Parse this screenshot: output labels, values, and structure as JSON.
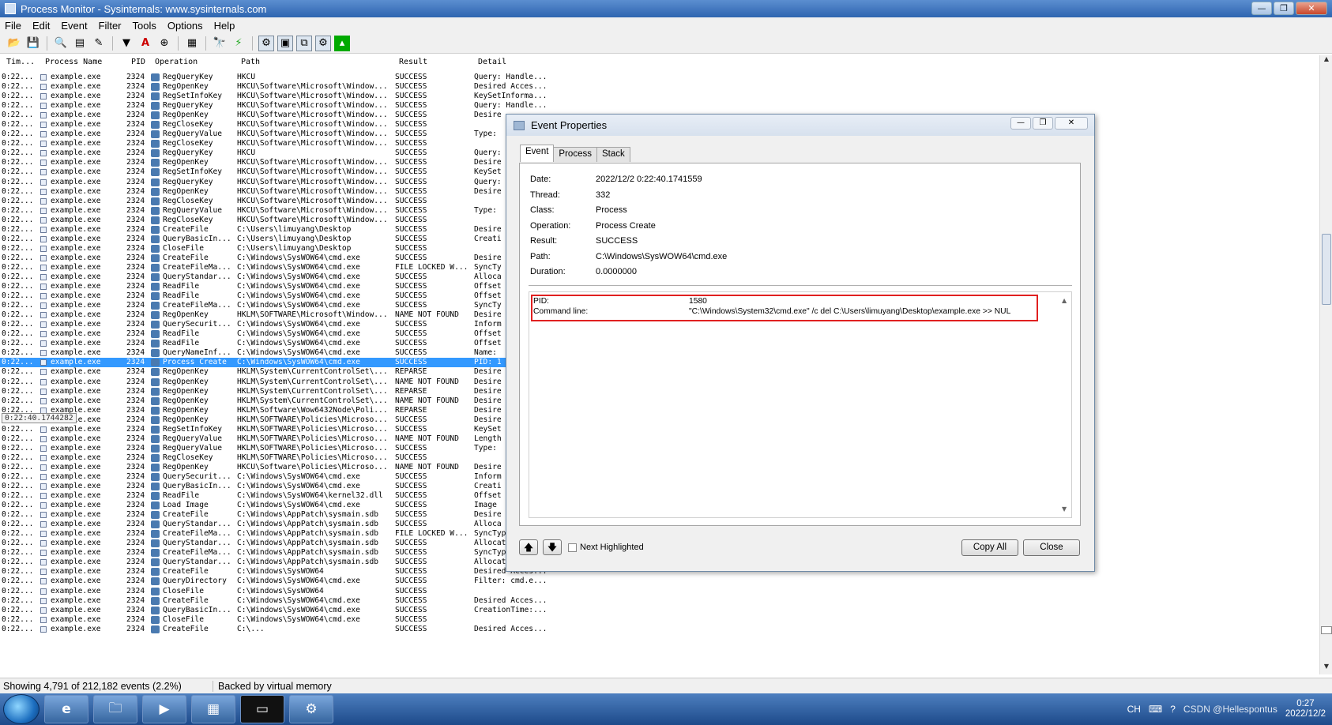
{
  "window": {
    "title": "Process Monitor - Sysinternals: www.sysinternals.com",
    "buttons": [
      "—",
      "❐",
      "✕"
    ]
  },
  "menu": [
    "File",
    "Edit",
    "Event",
    "Filter",
    "Tools",
    "Options",
    "Help"
  ],
  "columns": [
    "Tim...",
    "Process Name",
    "PID",
    "Operation",
    "Path",
    "Result",
    "Detail"
  ],
  "rows": [
    {
      "time": "0:22...",
      "proc": "example.exe",
      "pid": "2324",
      "op": "RegQueryKey",
      "path": "HKCU",
      "result": "SUCCESS",
      "detail": "Query: Handle..."
    },
    {
      "time": "0:22...",
      "proc": "example.exe",
      "pid": "2324",
      "op": "RegOpenKey",
      "path": "HKCU\\Software\\Microsoft\\Window...",
      "result": "SUCCESS",
      "detail": "Desired Acces..."
    },
    {
      "time": "0:22...",
      "proc": "example.exe",
      "pid": "2324",
      "op": "RegSetInfoKey",
      "path": "HKCU\\Software\\Microsoft\\Window...",
      "result": "SUCCESS",
      "detail": "KeySetInforma..."
    },
    {
      "time": "0:22...",
      "proc": "example.exe",
      "pid": "2324",
      "op": "RegQueryKey",
      "path": "HKCU\\Software\\Microsoft\\Window...",
      "result": "SUCCESS",
      "detail": "Query: Handle..."
    },
    {
      "time": "0:22...",
      "proc": "example.exe",
      "pid": "2324",
      "op": "RegOpenKey",
      "path": "HKCU\\Software\\Microsoft\\Window...",
      "result": "SUCCESS",
      "detail": "Desire"
    },
    {
      "time": "0:22...",
      "proc": "example.exe",
      "pid": "2324",
      "op": "RegCloseKey",
      "path": "HKCU\\Software\\Microsoft\\Window...",
      "result": "SUCCESS",
      "detail": ""
    },
    {
      "time": "0:22...",
      "proc": "example.exe",
      "pid": "2324",
      "op": "RegQueryValue",
      "path": "HKCU\\Software\\Microsoft\\Window...",
      "result": "SUCCESS",
      "detail": "Type:"
    },
    {
      "time": "0:22...",
      "proc": "example.exe",
      "pid": "2324",
      "op": "RegCloseKey",
      "path": "HKCU\\Software\\Microsoft\\Window...",
      "result": "SUCCESS",
      "detail": ""
    },
    {
      "time": "0:22...",
      "proc": "example.exe",
      "pid": "2324",
      "op": "RegQueryKey",
      "path": "HKCU",
      "result": "SUCCESS",
      "detail": "Query:"
    },
    {
      "time": "0:22...",
      "proc": "example.exe",
      "pid": "2324",
      "op": "RegOpenKey",
      "path": "HKCU\\Software\\Microsoft\\Window...",
      "result": "SUCCESS",
      "detail": "Desire"
    },
    {
      "time": "0:22...",
      "proc": "example.exe",
      "pid": "2324",
      "op": "RegSetInfoKey",
      "path": "HKCU\\Software\\Microsoft\\Window...",
      "result": "SUCCESS",
      "detail": "KeySet"
    },
    {
      "time": "0:22...",
      "proc": "example.exe",
      "pid": "2324",
      "op": "RegQueryKey",
      "path": "HKCU\\Software\\Microsoft\\Window...",
      "result": "SUCCESS",
      "detail": "Query:"
    },
    {
      "time": "0:22...",
      "proc": "example.exe",
      "pid": "2324",
      "op": "RegOpenKey",
      "path": "HKCU\\Software\\Microsoft\\Window...",
      "result": "SUCCESS",
      "detail": "Desire"
    },
    {
      "time": "0:22...",
      "proc": "example.exe",
      "pid": "2324",
      "op": "RegCloseKey",
      "path": "HKCU\\Software\\Microsoft\\Window...",
      "result": "SUCCESS",
      "detail": ""
    },
    {
      "time": "0:22...",
      "proc": "example.exe",
      "pid": "2324",
      "op": "RegQueryValue",
      "path": "HKCU\\Software\\Microsoft\\Window...",
      "result": "SUCCESS",
      "detail": "Type:"
    },
    {
      "time": "0:22...",
      "proc": "example.exe",
      "pid": "2324",
      "op": "RegCloseKey",
      "path": "HKCU\\Software\\Microsoft\\Window...",
      "result": "SUCCESS",
      "detail": ""
    },
    {
      "time": "0:22...",
      "proc": "example.exe",
      "pid": "2324",
      "op": "CreateFile",
      "path": "C:\\Users\\limuyang\\Desktop",
      "result": "SUCCESS",
      "detail": "Desire"
    },
    {
      "time": "0:22...",
      "proc": "example.exe",
      "pid": "2324",
      "op": "QueryBasicIn...",
      "path": "C:\\Users\\limuyang\\Desktop",
      "result": "SUCCESS",
      "detail": "Creati"
    },
    {
      "time": "0:22...",
      "proc": "example.exe",
      "pid": "2324",
      "op": "CloseFile",
      "path": "C:\\Users\\limuyang\\Desktop",
      "result": "SUCCESS",
      "detail": ""
    },
    {
      "time": "0:22...",
      "proc": "example.exe",
      "pid": "2324",
      "op": "CreateFile",
      "path": "C:\\Windows\\SysWOW64\\cmd.exe",
      "result": "SUCCESS",
      "detail": "Desire"
    },
    {
      "time": "0:22...",
      "proc": "example.exe",
      "pid": "2324",
      "op": "CreateFileMa...",
      "path": "C:\\Windows\\SysWOW64\\cmd.exe",
      "result": "FILE LOCKED W...",
      "detail": "SyncTy"
    },
    {
      "time": "0:22...",
      "proc": "example.exe",
      "pid": "2324",
      "op": "QueryStandar...",
      "path": "C:\\Windows\\SysWOW64\\cmd.exe",
      "result": "SUCCESS",
      "detail": "Alloca"
    },
    {
      "time": "0:22...",
      "proc": "example.exe",
      "pid": "2324",
      "op": "ReadFile",
      "path": "C:\\Windows\\SysWOW64\\cmd.exe",
      "result": "SUCCESS",
      "detail": "Offset"
    },
    {
      "time": "0:22...",
      "proc": "example.exe",
      "pid": "2324",
      "op": "ReadFile",
      "path": "C:\\Windows\\SysWOW64\\cmd.exe",
      "result": "SUCCESS",
      "detail": "Offset"
    },
    {
      "time": "0:22...",
      "proc": "example.exe",
      "pid": "2324",
      "op": "CreateFileMa...",
      "path": "C:\\Windows\\SysWOW64\\cmd.exe",
      "result": "SUCCESS",
      "detail": "SyncTy"
    },
    {
      "time": "0:22...",
      "proc": "example.exe",
      "pid": "2324",
      "op": "RegOpenKey",
      "path": "HKLM\\SOFTWARE\\Microsoft\\Window...",
      "result": "NAME NOT FOUND",
      "detail": "Desire"
    },
    {
      "time": "0:22...",
      "proc": "example.exe",
      "pid": "2324",
      "op": "QuerySecurit...",
      "path": "C:\\Windows\\SysWOW64\\cmd.exe",
      "result": "SUCCESS",
      "detail": "Inform"
    },
    {
      "time": "0:22...",
      "proc": "example.exe",
      "pid": "2324",
      "op": "ReadFile",
      "path": "C:\\Windows\\SysWOW64\\cmd.exe",
      "result": "SUCCESS",
      "detail": "Offset"
    },
    {
      "time": "0:22...",
      "proc": "example.exe",
      "pid": "2324",
      "op": "ReadFile",
      "path": "C:\\Windows\\SysWOW64\\cmd.exe",
      "result": "SUCCESS",
      "detail": "Offset"
    },
    {
      "time": "0:22...",
      "proc": "example.exe",
      "pid": "2324",
      "op": "QueryNameInf...",
      "path": "C:\\Windows\\SysWOW64\\cmd.exe",
      "result": "SUCCESS",
      "detail": "Name:"
    },
    {
      "time": "0:22...",
      "proc": "example.exe",
      "pid": "2324",
      "op": "Process Create",
      "path": "C:\\Windows\\SysWOW64\\cmd.exe",
      "result": "SUCCESS",
      "detail": "PID: 1",
      "selected": true
    },
    {
      "time": "0:22...",
      "proc": "example.exe",
      "pid": "2324",
      "op": "RegOpenKey",
      "path": "HKLM\\System\\CurrentControlSet\\...",
      "result": "REPARSE",
      "detail": "Desire"
    },
    {
      "time": "0:22...",
      "proc": "example.exe",
      "pid": "2324",
      "op": "RegOpenKey",
      "path": "HKLM\\System\\CurrentControlSet\\...",
      "result": "NAME NOT FOUND",
      "detail": "Desire"
    },
    {
      "time": "0:22...",
      "proc": "example.exe",
      "pid": "2324",
      "op": "RegOpenKey",
      "path": "HKLM\\System\\CurrentControlSet\\...",
      "result": "REPARSE",
      "detail": "Desire"
    },
    {
      "time": "0:22...",
      "proc": "example.exe",
      "pid": "2324",
      "op": "RegOpenKey",
      "path": "HKLM\\System\\CurrentControlSet\\...",
      "result": "NAME NOT FOUND",
      "detail": "Desire"
    },
    {
      "time": "0:22...",
      "proc": "example.exe",
      "pid": "2324",
      "op": "RegOpenKey",
      "path": "HKLM\\Software\\Wow6432Node\\Poli...",
      "result": "REPARSE",
      "detail": "Desire"
    },
    {
      "time": "0:22...",
      "proc": "example.exe",
      "pid": "2324",
      "op": "RegOpenKey",
      "path": "HKLM\\SOFTWARE\\Policies\\Microso...",
      "result": "SUCCESS",
      "detail": "Desire"
    },
    {
      "time": "0:22...",
      "proc": "example.exe",
      "pid": "2324",
      "op": "RegSetInfoKey",
      "path": "HKLM\\SOFTWARE\\Policies\\Microso...",
      "result": "SUCCESS",
      "detail": "KeySet"
    },
    {
      "time": "0:22...",
      "proc": "example.exe",
      "pid": "2324",
      "op": "RegQueryValue",
      "path": "HKLM\\SOFTWARE\\Policies\\Microso...",
      "result": "NAME NOT FOUND",
      "detail": "Length"
    },
    {
      "time": "0:22...",
      "proc": "example.exe",
      "pid": "2324",
      "op": "RegQueryValue",
      "path": "HKLM\\SOFTWARE\\Policies\\Microso...",
      "result": "SUCCESS",
      "detail": "Type:"
    },
    {
      "time": "0:22...",
      "proc": "example.exe",
      "pid": "2324",
      "op": "RegCloseKey",
      "path": "HKLM\\SOFTWARE\\Policies\\Microso...",
      "result": "SUCCESS",
      "detail": ""
    },
    {
      "time": "0:22...",
      "proc": "example.exe",
      "pid": "2324",
      "op": "RegOpenKey",
      "path": "HKCU\\Software\\Policies\\Microso...",
      "result": "NAME NOT FOUND",
      "detail": "Desire"
    },
    {
      "time": "0:22...",
      "proc": "example.exe",
      "pid": "2324",
      "op": "QuerySecurit...",
      "path": "C:\\Windows\\SysWOW64\\cmd.exe",
      "result": "SUCCESS",
      "detail": "Inform"
    },
    {
      "time": "0:22...",
      "proc": "example.exe",
      "pid": "2324",
      "op": "QueryBasicIn...",
      "path": "C:\\Windows\\SysWOW64\\cmd.exe",
      "result": "SUCCESS",
      "detail": "Creati"
    },
    {
      "time": "0:22...",
      "proc": "example.exe",
      "pid": "2324",
      "op": "ReadFile",
      "path": "C:\\Windows\\SysWOW64\\kernel32.dll",
      "result": "SUCCESS",
      "detail": "Offset"
    },
    {
      "time": "0:22...",
      "proc": "example.exe",
      "pid": "2324",
      "op": "Load Image",
      "path": "C:\\Windows\\SysWOW64\\cmd.exe",
      "result": "SUCCESS",
      "detail": "Image"
    },
    {
      "time": "0:22...",
      "proc": "example.exe",
      "pid": "2324",
      "op": "CreateFile",
      "path": "C:\\Windows\\AppPatch\\sysmain.sdb",
      "result": "SUCCESS",
      "detail": "Desire"
    },
    {
      "time": "0:22...",
      "proc": "example.exe",
      "pid": "2324",
      "op": "QueryStandar...",
      "path": "C:\\Windows\\AppPatch\\sysmain.sdb",
      "result": "SUCCESS",
      "detail": "Alloca"
    },
    {
      "time": "0:22...",
      "proc": "example.exe",
      "pid": "2324",
      "op": "CreateFileMa...",
      "path": "C:\\Windows\\AppPatch\\sysmain.sdb",
      "result": "FILE LOCKED W...",
      "detail": "SyncType: Syn..."
    },
    {
      "time": "0:22...",
      "proc": "example.exe",
      "pid": "2324",
      "op": "QueryStandar...",
      "path": "C:\\Windows\\AppPatch\\sysmain.sdb",
      "result": "SUCCESS",
      "detail": "AllocationSiz..."
    },
    {
      "time": "0:22...",
      "proc": "example.exe",
      "pid": "2324",
      "op": "CreateFileMa...",
      "path": "C:\\Windows\\AppPatch\\sysmain.sdb",
      "result": "SUCCESS",
      "detail": "SyncType: Syn..."
    },
    {
      "time": "0:22...",
      "proc": "example.exe",
      "pid": "2324",
      "op": "QueryStandar...",
      "path": "C:\\Windows\\AppPatch\\sysmain.sdb",
      "result": "SUCCESS",
      "detail": "AllocationSiz..."
    },
    {
      "time": "0:22...",
      "proc": "example.exe",
      "pid": "2324",
      "op": "CreateFile",
      "path": "C:\\Windows\\SysWOW64",
      "result": "SUCCESS",
      "detail": "Desired Acces..."
    },
    {
      "time": "0:22...",
      "proc": "example.exe",
      "pid": "2324",
      "op": "QueryDirectory",
      "path": "C:\\Windows\\SysWOW64\\cmd.exe",
      "result": "SUCCESS",
      "detail": "Filter: cmd.e..."
    },
    {
      "time": "0:22...",
      "proc": "example.exe",
      "pid": "2324",
      "op": "CloseFile",
      "path": "C:\\Windows\\SysWOW64",
      "result": "SUCCESS",
      "detail": ""
    },
    {
      "time": "0:22...",
      "proc": "example.exe",
      "pid": "2324",
      "op": "CreateFile",
      "path": "C:\\Windows\\SysWOW64\\cmd.exe",
      "result": "SUCCESS",
      "detail": "Desired Acces..."
    },
    {
      "time": "0:22...",
      "proc": "example.exe",
      "pid": "2324",
      "op": "QueryBasicIn...",
      "path": "C:\\Windows\\SysWOW64\\cmd.exe",
      "result": "SUCCESS",
      "detail": "CreationTime:..."
    },
    {
      "time": "0:22...",
      "proc": "example.exe",
      "pid": "2324",
      "op": "CloseFile",
      "path": "C:\\Windows\\SysWOW64\\cmd.exe",
      "result": "SUCCESS",
      "detail": ""
    },
    {
      "time": "0:22...",
      "proc": "example.exe",
      "pid": "2324",
      "op": "CreateFile",
      "path": "C:\\...",
      "result": "SUCCESS",
      "detail": "Desired Acces..."
    }
  ],
  "tooltip": "0:22:40.1744282",
  "status": {
    "events": "Showing 4,791 of 212,182 events (2.2%)",
    "memory": "Backed by virtual memory"
  },
  "dialog": {
    "title": "Event Properties",
    "tabs": [
      "Event",
      "Process",
      "Stack"
    ],
    "props": [
      {
        "label": "Date:",
        "value": "2022/12/2 0:22:40.1741559"
      },
      {
        "label": "Thread:",
        "value": "332"
      },
      {
        "label": "Class:",
        "value": "Process"
      },
      {
        "label": "Operation:",
        "value": "Process Create"
      },
      {
        "label": "Result:",
        "value": "SUCCESS"
      },
      {
        "label": "Path:",
        "value": "C:\\Windows\\SysWOW64\\cmd.exe"
      },
      {
        "label": "Duration:",
        "value": "0.0000000"
      }
    ],
    "details": [
      {
        "label": "PID:",
        "value": "1580"
      },
      {
        "label": "Command line:",
        "value": "\"C:\\Windows\\System32\\cmd.exe\" /c del C:\\Users\\limuyang\\Desktop\\example.exe >> NUL"
      }
    ],
    "next_highlighted": "Next Highlighted",
    "copy_all": "Copy All",
    "close": "Close"
  },
  "tray": {
    "lang": "CH",
    "watermark": "CSDN @Hellespontus",
    "time": "0:27",
    "date": "2022/12/2"
  },
  "colors": {
    "selection": "#3399ff",
    "highlight_box": "#e02020"
  }
}
